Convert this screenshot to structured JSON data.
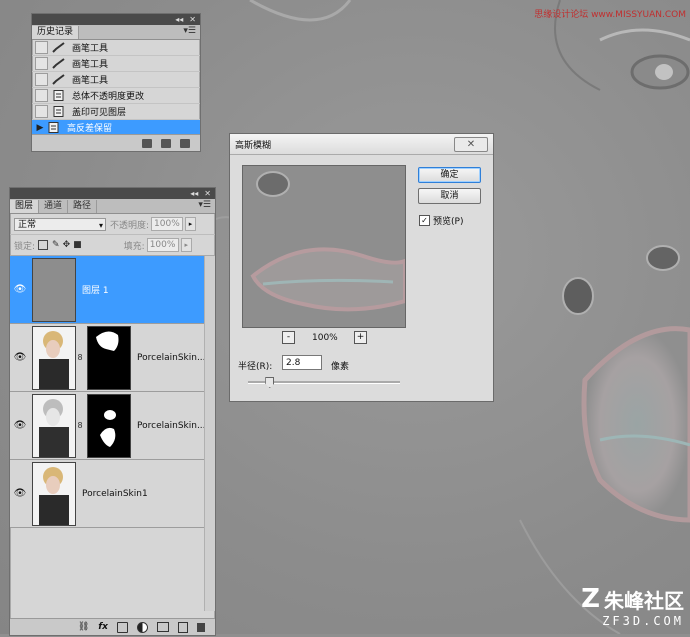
{
  "watermark_top": "思缘设计论坛 www.MISSYUAN.COM",
  "watermark_bottom": "朱峰社区",
  "watermark_bottom_sub": "ZF3D.COM",
  "history_panel": {
    "tab": "历史记录",
    "items": [
      {
        "label": "画笔工具",
        "icon": "brush-icon",
        "selected": false
      },
      {
        "label": "画笔工具",
        "icon": "brush-icon",
        "selected": false
      },
      {
        "label": "画笔工具",
        "icon": "brush-icon",
        "selected": false
      },
      {
        "label": "总体不透明度更改",
        "icon": "history-state-icon",
        "selected": false
      },
      {
        "label": "盖印可见图层",
        "icon": "history-state-icon",
        "selected": false
      },
      {
        "label": "高反差保留",
        "icon": "history-state-icon",
        "selected": true
      }
    ]
  },
  "layers_panel": {
    "tabs": [
      "图层",
      "通道",
      "路径"
    ],
    "blend_mode": "正常",
    "opacity_label": "不透明度:",
    "opacity_value": "100%",
    "lock_label": "锁定:",
    "fill_label": "填充:",
    "fill_value": "100%",
    "layers": [
      {
        "name": "图层 1",
        "selected": true,
        "has_mask": false
      },
      {
        "name": "PorcelainSkin...",
        "selected": false,
        "has_mask": true
      },
      {
        "name": "PorcelainSkin...",
        "selected": false,
        "has_mask": true
      },
      {
        "name": "PorcelainSkin1",
        "selected": false,
        "has_mask": false
      }
    ],
    "footer_icons": [
      "link-icon",
      "fx-icon",
      "mask-icon",
      "adjustment-icon",
      "group-icon",
      "new-layer-icon",
      "trash-icon"
    ]
  },
  "gaussian_dialog": {
    "title": "高斯模糊",
    "ok": "确定",
    "cancel": "取消",
    "preview_label": "预览(P)",
    "preview_checked": true,
    "zoom_minus": "-",
    "zoom_plus": "+",
    "zoom": "100%",
    "radius_label": "半径(R):",
    "radius_value": "2.8",
    "radius_unit": "像素",
    "radius_slider_fraction": 0.14
  }
}
